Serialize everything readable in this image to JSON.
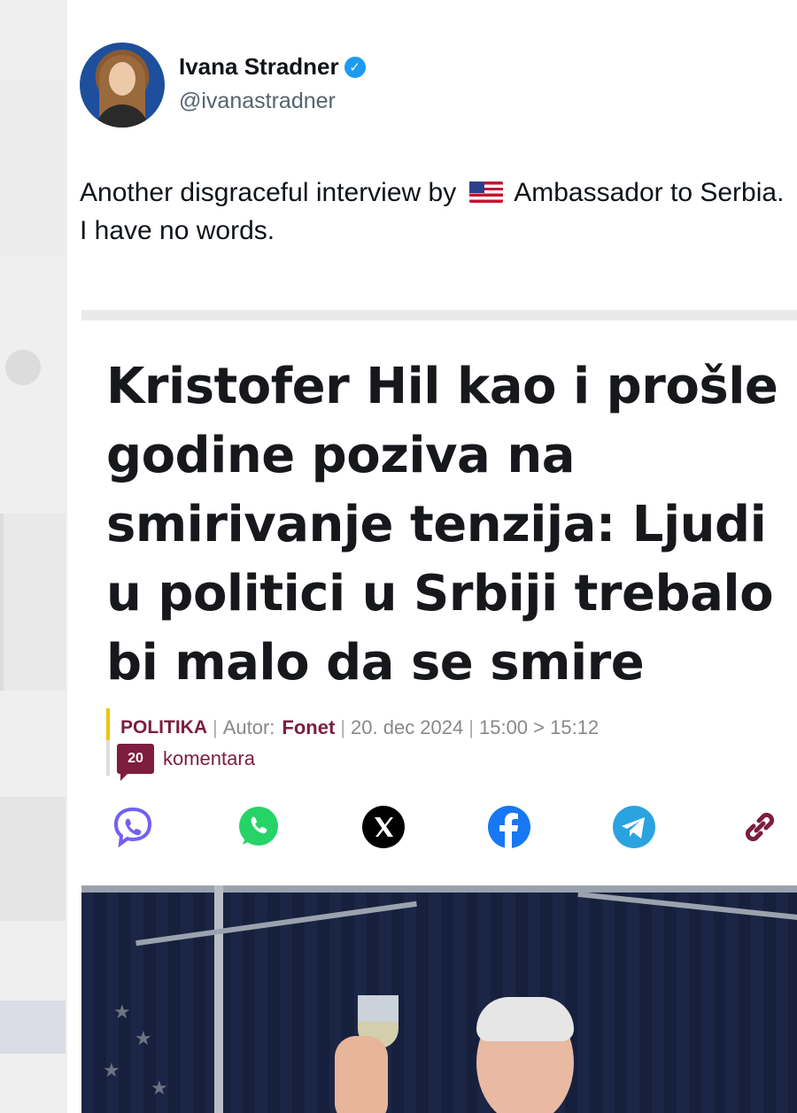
{
  "tweet": {
    "author_name": "Ivana Stradner",
    "handle": "@ivanastradner",
    "text_before_flag": "Another disgraceful interview by",
    "text_after_flag": "Ambassador to Serbia. I have no words."
  },
  "article": {
    "headline": "Kristofer Hil kao i prošle godine poziva na smirivanje tenzija: Ljudi u politici u Srbiji trebalo bi malo da se smire",
    "category": "POLITIKA",
    "author_label": "Autor:",
    "author": "Fonet",
    "date": "20. dec 2024",
    "time": "15:00 > 15:12",
    "comment_count": "20",
    "comment_label": "komentara"
  },
  "share": [
    {
      "name": "viber-icon",
      "color": "#7360f2"
    },
    {
      "name": "whatsapp-icon",
      "color": "#25d366"
    },
    {
      "name": "x-icon",
      "color": "#000000"
    },
    {
      "name": "facebook-icon",
      "color": "#1877f2"
    },
    {
      "name": "telegram-icon",
      "color": "#2aa3e0"
    },
    {
      "name": "link-icon",
      "color": "#7d1d3f"
    }
  ],
  "colors": {
    "verified": "#1d9bf0",
    "brand": "#7d1d3f",
    "meta_accent": "#f0c400"
  }
}
